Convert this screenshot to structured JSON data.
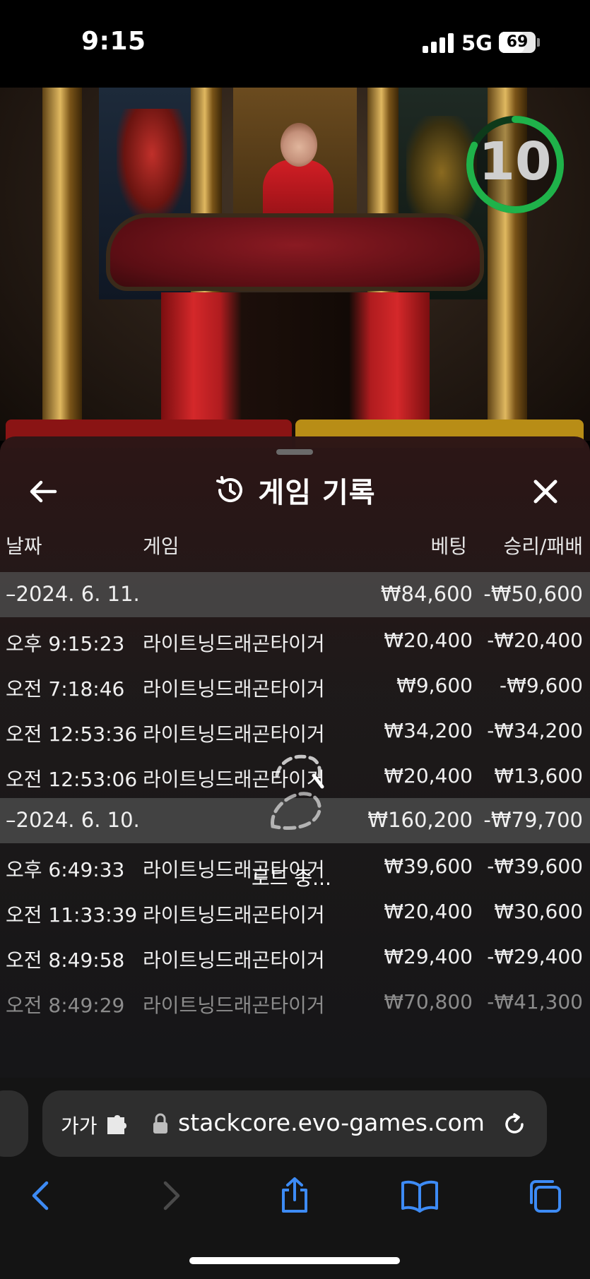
{
  "status_bar": {
    "time": "9:15",
    "network": "5G",
    "battery": "69",
    "battery_level": 0.69
  },
  "video": {
    "timer": "10",
    "timer_progress": 0.82
  },
  "sheet": {
    "title": "게임 기록",
    "columns": {
      "date": "날짜",
      "game": "게임",
      "bet": "베팅",
      "win_loss": "승리/패배"
    },
    "groups": [
      {
        "date": "–2024. 6. 11.",
        "bet": "₩84,600",
        "win_loss": "-₩50,600",
        "rows": [
          {
            "time": "오후 9:15:23",
            "game": "라이트닝드래곤타이거",
            "bet": "₩20,400",
            "win_loss": "-₩20,400"
          },
          {
            "time": "오전 7:18:46",
            "game": "라이트닝드래곤타이거",
            "bet": "₩9,600",
            "win_loss": "-₩9,600"
          },
          {
            "time": "오전 12:53:36",
            "game": "라이트닝드래곤타이거",
            "bet": "₩34,200",
            "win_loss": "-₩34,200"
          },
          {
            "time": "오전 12:53:06",
            "game": "라이트닝드래곤타이거",
            "bet": "₩20,400",
            "win_loss": "₩13,600"
          }
        ]
      },
      {
        "date": "–2024. 6. 10.",
        "bet": "₩160,200",
        "win_loss": "-₩79,700",
        "rows": [
          {
            "time": "오후 6:49:33",
            "game": "라이트닝드래곤타이거",
            "bet": "₩39,600",
            "win_loss": "-₩39,600"
          },
          {
            "time": "오전 11:33:39",
            "game": "라이트닝드래곤타이거",
            "bet": "₩20,400",
            "win_loss": "₩30,600"
          },
          {
            "time": "오전 8:49:58",
            "game": "라이트닝드래곤타이거",
            "bet": "₩29,400",
            "win_loss": "-₩29,400"
          },
          {
            "time": "오전 8:49:29",
            "game": "라이트닝드래곤타이거",
            "bet": "₩70,800",
            "win_loss": "-₩41,300"
          }
        ]
      }
    ],
    "loading_text": "로드 중..."
  },
  "browser": {
    "text_size_label": "가가",
    "url": "stackcore.evo-games.com",
    "accent_color": "#3d8bf5"
  }
}
